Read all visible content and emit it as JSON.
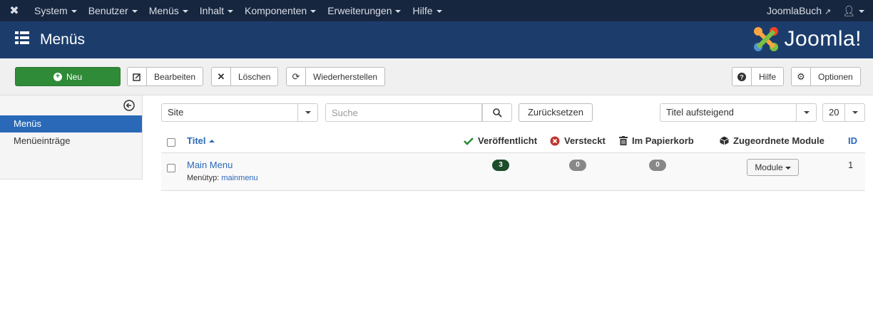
{
  "topnav": {
    "items": [
      "System",
      "Benutzer",
      "Menüs",
      "Inhalt",
      "Komponenten",
      "Erweiterungen",
      "Hilfe"
    ],
    "site_link": "JoomlaBuch"
  },
  "header": {
    "title": "Menüs",
    "brand": "Joomla!"
  },
  "toolbar": {
    "new": "Neu",
    "edit": "Bearbeiten",
    "delete": "Löschen",
    "restore": "Wiederherstellen",
    "help": "Hilfe",
    "options": "Optionen"
  },
  "sidebar": {
    "items": [
      "Menüs",
      "Menüeinträge"
    ]
  },
  "filters": {
    "client": "Site",
    "search_placeholder": "Suche",
    "reset": "Zurücksetzen",
    "ordering": "Titel aufsteigend",
    "limit": "20"
  },
  "table": {
    "headers": {
      "title": "Titel",
      "published": "Veröffentlicht",
      "unpublished": "Versteckt",
      "trashed": "Im Papierkorb",
      "modules": "Zugeordnete Module",
      "id": "ID"
    },
    "rows": [
      {
        "title": "Main Menu",
        "type_label": "Menütyp:",
        "type_value": "mainmenu",
        "published": "3",
        "unpublished": "0",
        "trashed": "0",
        "modules_button": "Module",
        "id": "1"
      }
    ]
  },
  "colors": {
    "navbar": "#17263f",
    "header": "#1c3d6c",
    "new_button": "#2f8b38",
    "link": "#2a69b8",
    "active_sidebar": "#2a69b8"
  }
}
